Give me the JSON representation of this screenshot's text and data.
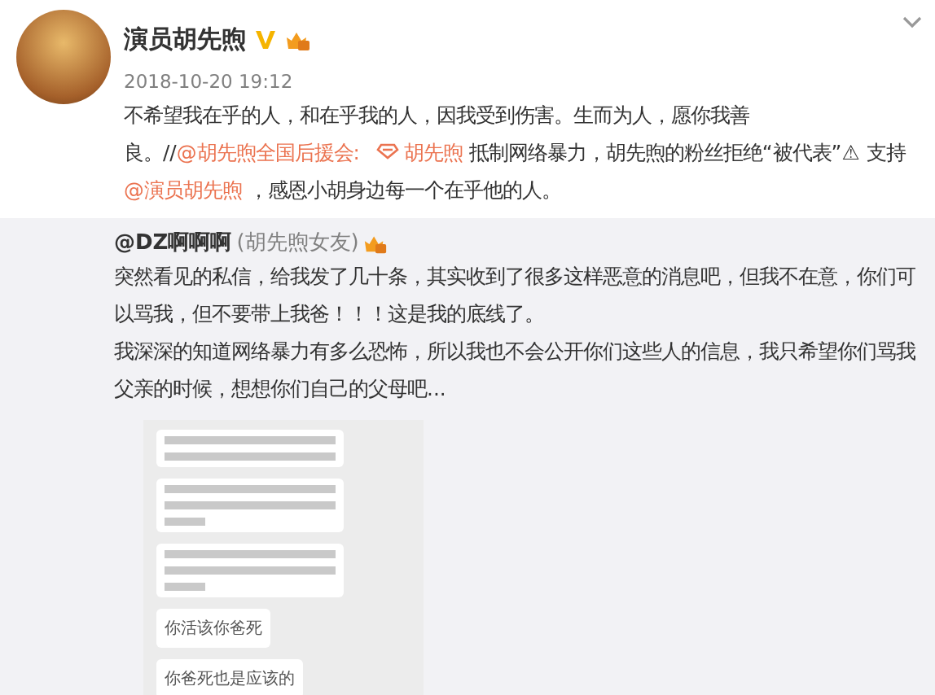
{
  "post": {
    "author": "演员胡先煦",
    "time": "2018-10-20 19:12",
    "text": [
      {
        "kind": "text",
        "text": "不希望我在乎的人，和在乎我的人，因我受到伤害。生而为人，愿你我善良。//"
      },
      {
        "kind": "mention",
        "text": "@胡先煦全国后援会:"
      },
      {
        "kind": "topic",
        "text": "胡先煦"
      },
      {
        "kind": "text",
        "text": " 抵制网络暴力，胡先煦的粉丝拒绝“被代表”⚠ 支持 "
      },
      {
        "kind": "mention",
        "text": "@演员胡先煦"
      },
      {
        "kind": "text",
        "text": " ，感恩小胡身边每一个在乎他的人。"
      }
    ]
  },
  "repost": {
    "author": "@DZ啊啊啊",
    "remark": "(胡先煦女友)",
    "paragraphs": [
      "突然看见的私信，给我发了几十条，其实收到了很多这样恶意的消息吧，但我不在意，你们可以骂我，但不要带上我爸！！！这是我的底线了。",
      "我深深的知道网络暴力有多么恐怖，所以我也不会公开你们这些人的信息，我只希望你们骂我父亲的时候，想想你们自己的父母吧..."
    ],
    "messages": [
      {
        "kind": "blurred"
      },
      {
        "kind": "blurred"
      },
      {
        "kind": "blurred"
      },
      {
        "kind": "text",
        "text": "你活该你爸死"
      },
      {
        "kind": "text",
        "text": "你爸死也是应该的"
      }
    ]
  }
}
